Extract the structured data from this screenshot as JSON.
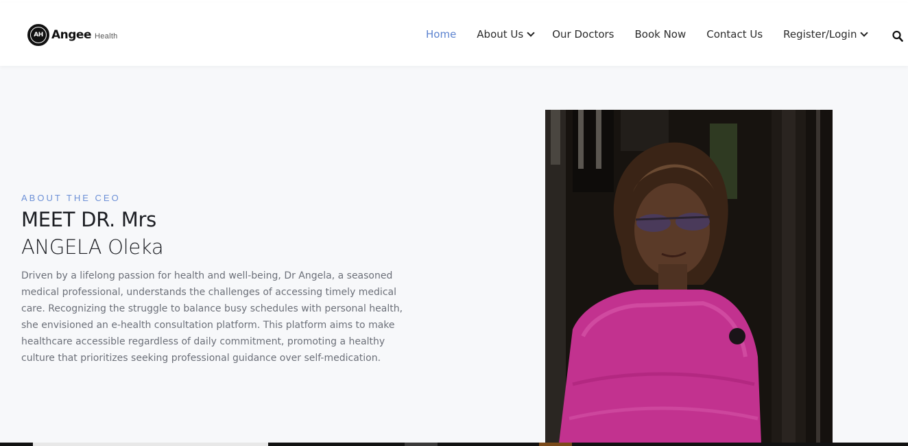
{
  "brand": {
    "mark": "AH",
    "name": "Angee",
    "tagline": "Health"
  },
  "nav": {
    "items": [
      {
        "label": "Home",
        "active": true
      },
      {
        "label": "About Us",
        "dropdown": true
      },
      {
        "label": "Our Doctors"
      },
      {
        "label": "Book Now"
      },
      {
        "label": "Contact Us"
      },
      {
        "label": "Register/Login",
        "dropdown": true
      }
    ],
    "search_icon": "search-icon"
  },
  "hero": {
    "eyebrow": "ABOUT THE CEO",
    "title_line1": "MEET DR. Mrs",
    "title_line2": "ANGELA Oleka",
    "description": "Driven by a lifelong passion for health and well-being, Dr Angela, a seasoned medical professional, understands the challenges of accessing timely medical care. Recognizing the struggle to balance busy schedules with personal health, she envisioned an e-health consultation platform. This platform aims to make healthcare accessible regardless of daily commitment, promoting a healthy culture that prioritizes seeking professional guidance over self-medication."
  },
  "colors": {
    "accent": "#5b82cf",
    "eyebrow": "#6b8fd6",
    "heading": "#1b1d22",
    "body_text": "#6b6f78",
    "background": "#f7f8fa",
    "dress": "#c2328f"
  }
}
